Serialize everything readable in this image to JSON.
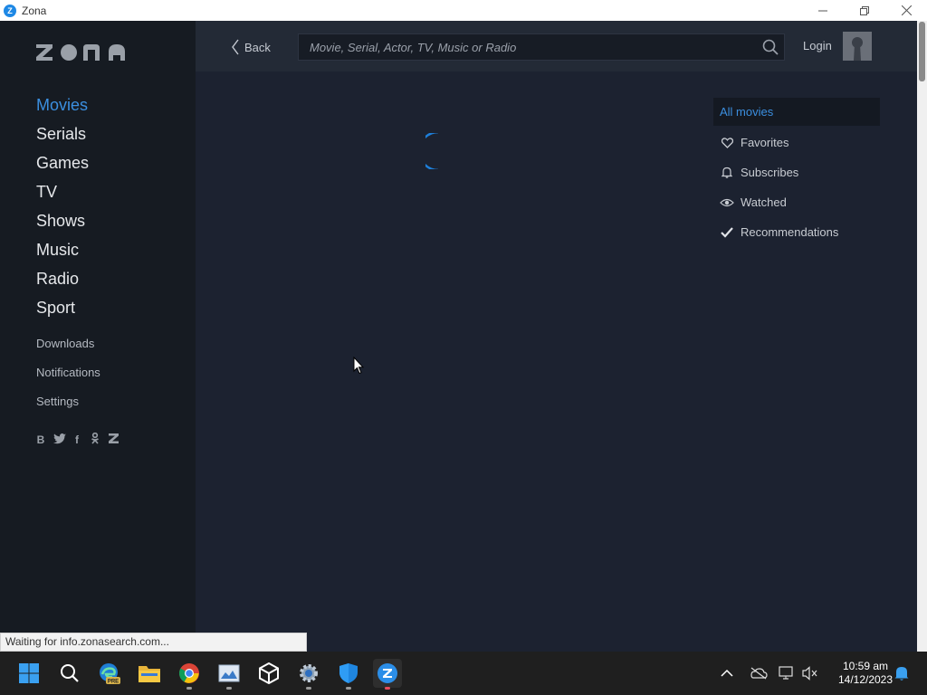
{
  "window": {
    "title": "Zona",
    "app_icon_letter": "Z"
  },
  "sidebar": {
    "logo_text": "zona",
    "main_items": [
      {
        "label": "Movies",
        "active": true
      },
      {
        "label": "Serials"
      },
      {
        "label": "Games"
      },
      {
        "label": "TV"
      },
      {
        "label": "Shows"
      },
      {
        "label": "Music"
      },
      {
        "label": "Radio"
      },
      {
        "label": "Sport"
      }
    ],
    "sub_items": [
      {
        "label": "Downloads"
      },
      {
        "label": "Notifications"
      },
      {
        "label": "Settings"
      }
    ],
    "social_icons": [
      "vk-icon",
      "twitter-icon",
      "facebook-icon",
      "odnoklassniki-icon",
      "zona-icon"
    ]
  },
  "header": {
    "back_label": "Back",
    "search_placeholder": "Movie, Serial, Actor, TV, Music or Radio",
    "login_label": "Login"
  },
  "filters": [
    {
      "label": "All movies",
      "icon": "none",
      "active": true
    },
    {
      "label": "Favorites",
      "icon": "heart-icon"
    },
    {
      "label": "Subscribes",
      "icon": "bell-icon"
    },
    {
      "label": "Watched",
      "icon": "eye-icon"
    },
    {
      "label": "Recommendations",
      "icon": "checkmark-icon"
    }
  ],
  "status_bar": {
    "text": "Waiting for info.zonasearch.com..."
  },
  "taskbar": {
    "time": "10:59 am",
    "date": "14/12/2023",
    "edge_badge": "PRE"
  },
  "colors": {
    "accent": "#3b8fe0",
    "sidebar_bg": "#161b22",
    "content_bg": "#1c2230",
    "header_bg": "#232a36"
  }
}
